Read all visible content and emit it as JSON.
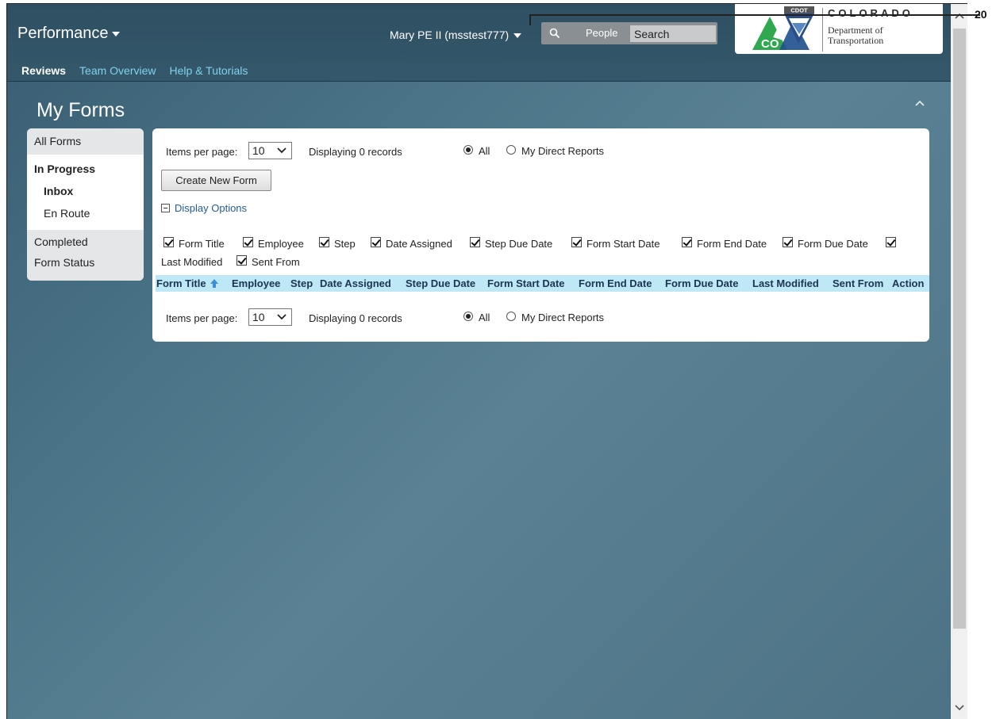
{
  "app": {
    "name": "Performance"
  },
  "header": {
    "user_label": "Mary PE II (msstest777)",
    "search_scope": "People",
    "search_placeholder": "Search"
  },
  "logo": {
    "badge_text": "CDOT",
    "mark_text": "CO",
    "state": "COLORADO",
    "dept_line1": "Department of",
    "dept_line2": "Transportation"
  },
  "nav": {
    "items": [
      "Reviews",
      "Team Overview",
      "Help & Tutorials"
    ],
    "active": "Reviews"
  },
  "page": {
    "title": "My Forms"
  },
  "sidebar": {
    "items": [
      {
        "label": "All Forms"
      },
      {
        "label": "In Progress"
      },
      {
        "label": "Inbox"
      },
      {
        "label": "En Route"
      },
      {
        "label": "Completed"
      },
      {
        "label": "Form Status"
      }
    ]
  },
  "panel": {
    "items_per_page_label": "Items per page:",
    "items_per_page_value": "10",
    "displaying": "Displaying 0 records",
    "filter_all": "All",
    "filter_direct": "My Direct Reports",
    "filter_selected": "All",
    "create_button": "Create New Form",
    "display_options": "Display Options",
    "columns_toggles": [
      {
        "label": "Form Title",
        "checked": true
      },
      {
        "label": "Employee",
        "checked": true
      },
      {
        "label": "Step",
        "checked": true
      },
      {
        "label": "Date Assigned",
        "checked": true
      },
      {
        "label": "Step Due Date",
        "checked": true
      },
      {
        "label": "Form Start Date",
        "checked": true
      },
      {
        "label": "Form End Date",
        "checked": true
      },
      {
        "label": "Form Due Date",
        "checked": true
      },
      {
        "label": "Last Modified",
        "checked": true
      },
      {
        "label": "Sent From",
        "checked": true
      }
    ],
    "table_headers": [
      "Form Title",
      "Employee",
      "Step",
      "Date Assigned",
      "Step Due Date",
      "Form Start Date",
      "Form End Date",
      "Form Due Date",
      "Last Modified",
      "Sent From",
      "Action"
    ],
    "sort_column": "Form Title",
    "sort_direction": "ascending"
  },
  "annotation": {
    "callout_number": "20"
  },
  "colors": {
    "header_bg": "#2f4f62",
    "page_bg": "#4a7387",
    "nav_link": "#7fd3ee",
    "table_header_bg": "#bfe8f6",
    "logo_green": "#2fa84f",
    "logo_blue": "#1e4f8f"
  }
}
